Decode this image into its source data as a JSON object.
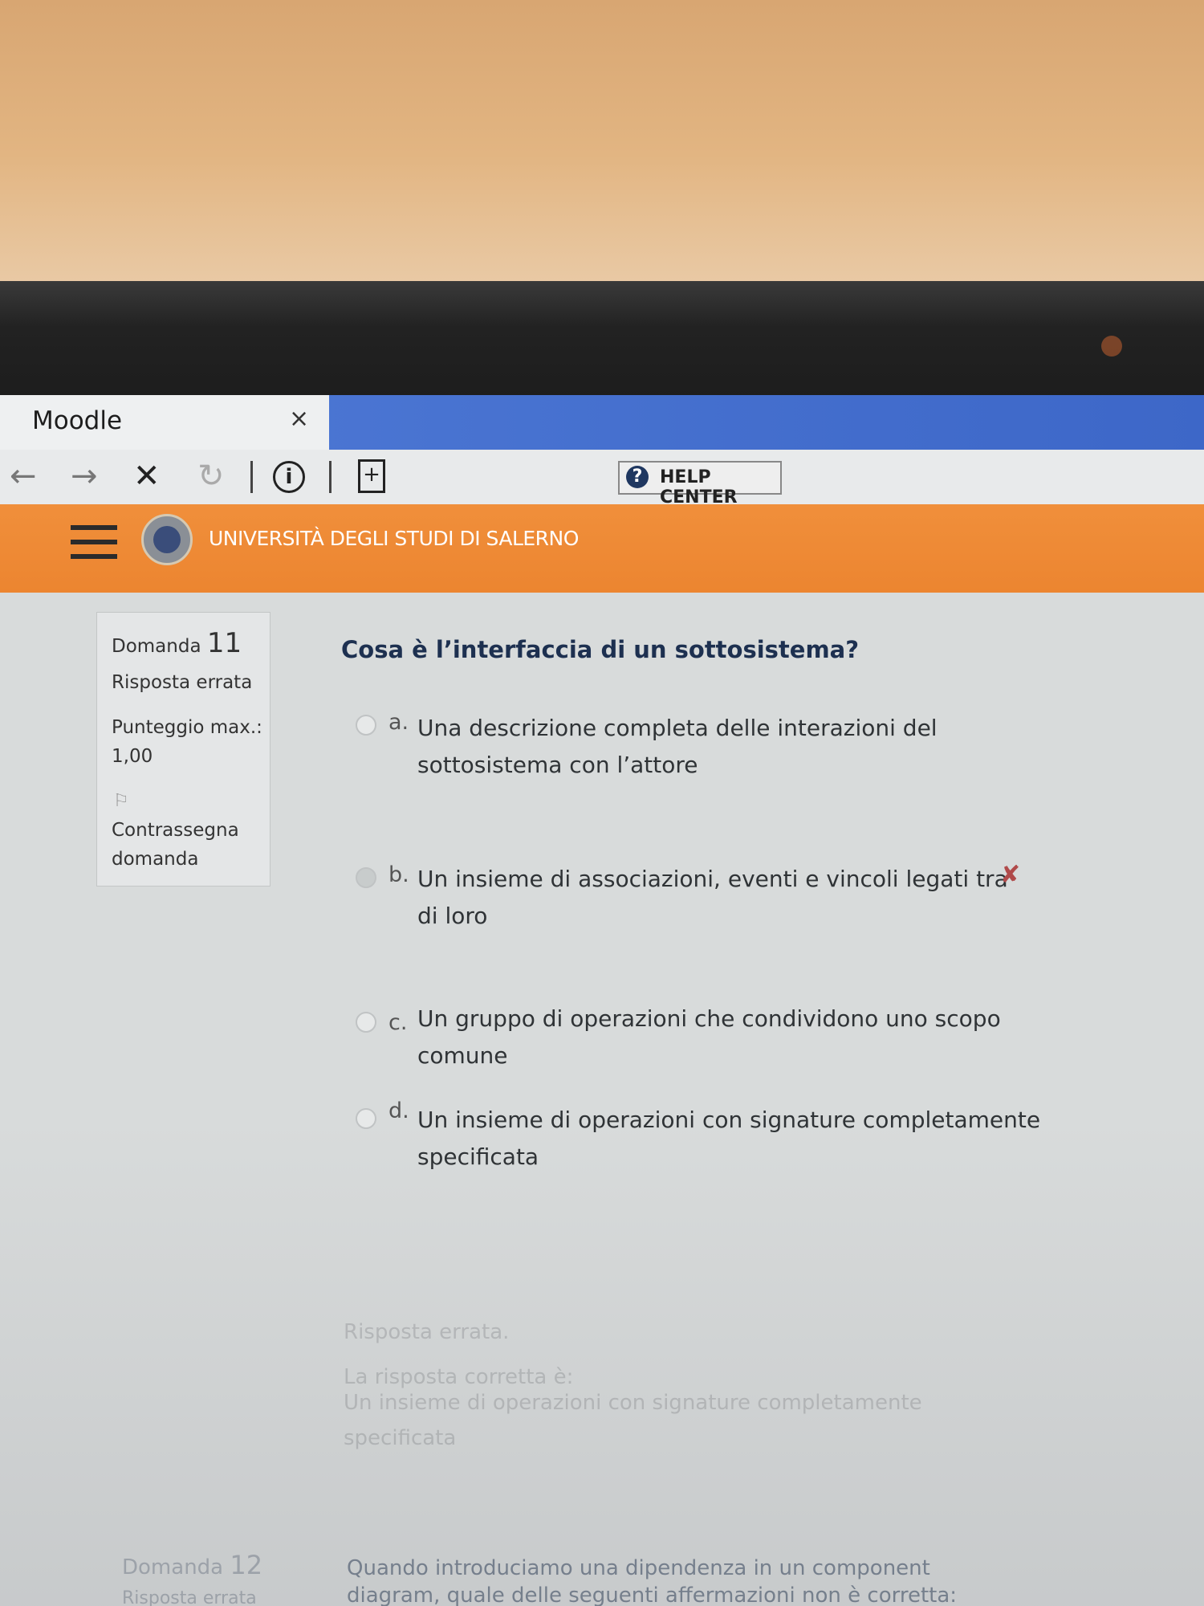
{
  "browser": {
    "tab_title": "Moodle",
    "tab_close": "×",
    "help_center_label": "HELP CENTER",
    "help_icon": "?"
  },
  "site": {
    "university_name": "UNIVERSITÀ DEGLI STUDI DI SALERNO"
  },
  "question_info": {
    "label": "Domanda",
    "number": "11",
    "state": "Risposta errata",
    "max_score_label": "Punteggio max.:",
    "max_score_value": "1,00",
    "flag_label_1": "Contrassegna",
    "flag_label_2": "domanda"
  },
  "question": {
    "text": "Cosa è l’interfaccia di un sottosistema?",
    "answers": [
      {
        "letter": "a.",
        "line1": "Una descrizione completa delle interazioni del",
        "line2": "sottosistema con l’attore"
      },
      {
        "letter": "b.",
        "line1": "Un insieme di associazioni, eventi e vincoli legati tra",
        "line2": "di loro",
        "selected": true,
        "mark": "✘"
      },
      {
        "letter": "c.",
        "line1": "Un gruppo di operazioni che condividono uno scopo",
        "line2": "comune"
      },
      {
        "letter": "d.",
        "line1": "Un insieme di operazioni con signature completamente",
        "line2": "specificata"
      }
    ]
  },
  "feedback": {
    "status": "Risposta errata.",
    "correct_label": "La risposta corretta è:",
    "correct_line1": "Un insieme di operazioni con signature completamente",
    "correct_line2": "specificata"
  },
  "next_question": {
    "label": "Domanda",
    "number": "12",
    "state": "Risposta errata",
    "text_line1": "Quando introduciamo una dipendenza in un component",
    "text_line2": "diagram, quale delle seguenti affermazioni non è corretta:"
  },
  "colors": {
    "accent_orange": "#ec8530",
    "tab_blue": "#3d67c8",
    "question_text": "#1d3050",
    "wrong_mark": "#b04a4a"
  }
}
